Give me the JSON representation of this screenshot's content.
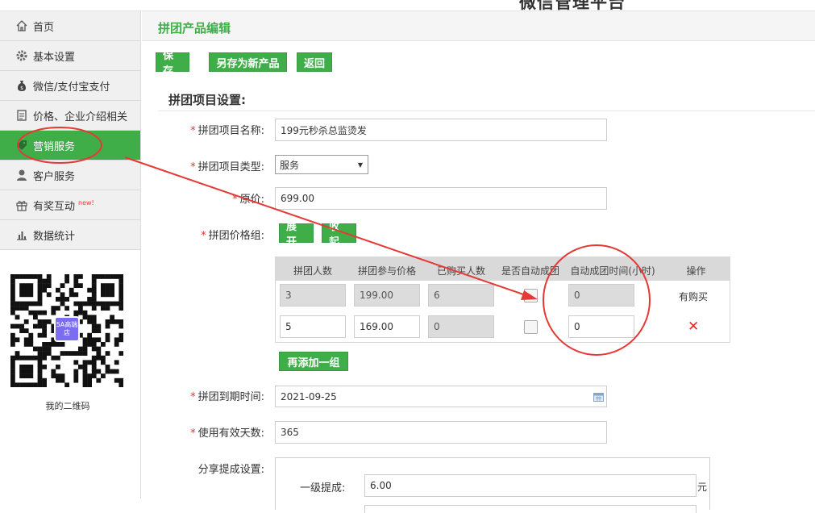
{
  "header": {
    "system_title": "微信管理平台"
  },
  "sidebar": {
    "items": [
      {
        "label": "首页",
        "icon": "home-icon"
      },
      {
        "label": "基本设置",
        "icon": "gear-icon"
      },
      {
        "label": "微信/支付宝支付",
        "icon": "money-bag-icon"
      },
      {
        "label": "价格、企业介绍相关",
        "icon": "document-icon"
      },
      {
        "label": "营销服务",
        "icon": "tag-icon",
        "active": true
      },
      {
        "label": "客户服务",
        "icon": "user-icon"
      },
      {
        "label": "有奖互动",
        "icon": "gift-icon",
        "badge": "new!"
      },
      {
        "label": "数据统计",
        "icon": "bar-chart-icon"
      }
    ],
    "qr_badge": "5A高端店",
    "qr_caption": "我的二维码"
  },
  "page": {
    "title": "拼团产品编辑",
    "buttons": {
      "save": "保存",
      "save_as_new": "另存为新产品",
      "back": "返回"
    },
    "section_title": "拼团项目设置:"
  },
  "form": {
    "name_label": "拼团项目名称:",
    "name_value": "199元秒杀总监烫发",
    "type_label": "拼团项目类型:",
    "type_value": "服务",
    "original_price_label": "原价:",
    "original_price_value": "699.00",
    "price_group_label": "拼团价格组:",
    "expand_button": "展开",
    "collapse_button": "收起",
    "add_group_button": "再添加一组",
    "expire_label": "拼团到期时间:",
    "expire_value": "2021-09-25",
    "valid_days_label": "使用有效天数:",
    "valid_days_value": "365",
    "share_label": "分享提成设置:",
    "level1_label": "一级提成:",
    "level1_value": "6.00",
    "level1_unit": "元"
  },
  "price_table": {
    "headers": [
      "拼团人数",
      "拼团参与价格",
      "已购买人数",
      "是否自动成团",
      "自动成团时间(小时)",
      "操作"
    ],
    "rows": [
      {
        "people": "3",
        "price": "199.00",
        "bought": "6",
        "auto_time": "0",
        "operation": "有购买"
      },
      {
        "people": "5",
        "price": "169.00",
        "bought": "0",
        "auto_time": "0",
        "operation": "✕"
      }
    ]
  },
  "annotation_colors": {
    "circle": "#e53935",
    "arrow": "#e53935"
  },
  "colors": {
    "accent": "#3fae49",
    "required": "#e33333"
  }
}
